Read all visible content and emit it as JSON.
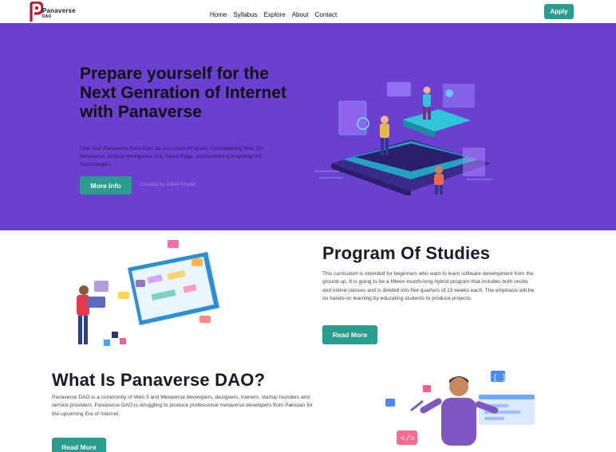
{
  "nav": {
    "logo_text": "Panaverse",
    "logo_subtext": "DAO",
    "links": [
      "Home",
      "Syllabus",
      "Explore",
      "About",
      "Contact"
    ],
    "apply_label": "Apply"
  },
  "hero": {
    "title": "Prepare yourself for the Next Genration of Internet with Panaverse",
    "description": "One Year Panaverse DAO Earn as you Learn Program. Consolidating Web 3.0 Metaverse, Artifical Intelligence (AI), Cloud Edge, and Ambient Computing/ IoT Technologies",
    "button_label": "More Info",
    "credit": "Created by Adeel Khalid"
  },
  "program": {
    "title": "Program Of Studies",
    "description": "This curriculum is intended for beginners who want to learn software development from the ground up. It is going to be a fifteen-month-long hybrid program that includes both onsite and online classes and is divided into five quarters of 13 weeks each. The emphasis will be on hands-on learning by educating students to produce projects.",
    "button_label": "Read More"
  },
  "what_is": {
    "title": "What Is Panaverse DAO?",
    "description": "Panaverse DAO is a community of Web 3 and Metaverse developers, designers, trainers, startup founders and service providers. Panaverse DAO is struggling to produce professional metaverse developers from Pakistan for the upcoming Era of Internet.",
    "button_label": "Read More"
  },
  "colors": {
    "hero_bg": "#6b3fd0",
    "accent": "#2a9d8f",
    "logo_red": "#c8102e"
  }
}
